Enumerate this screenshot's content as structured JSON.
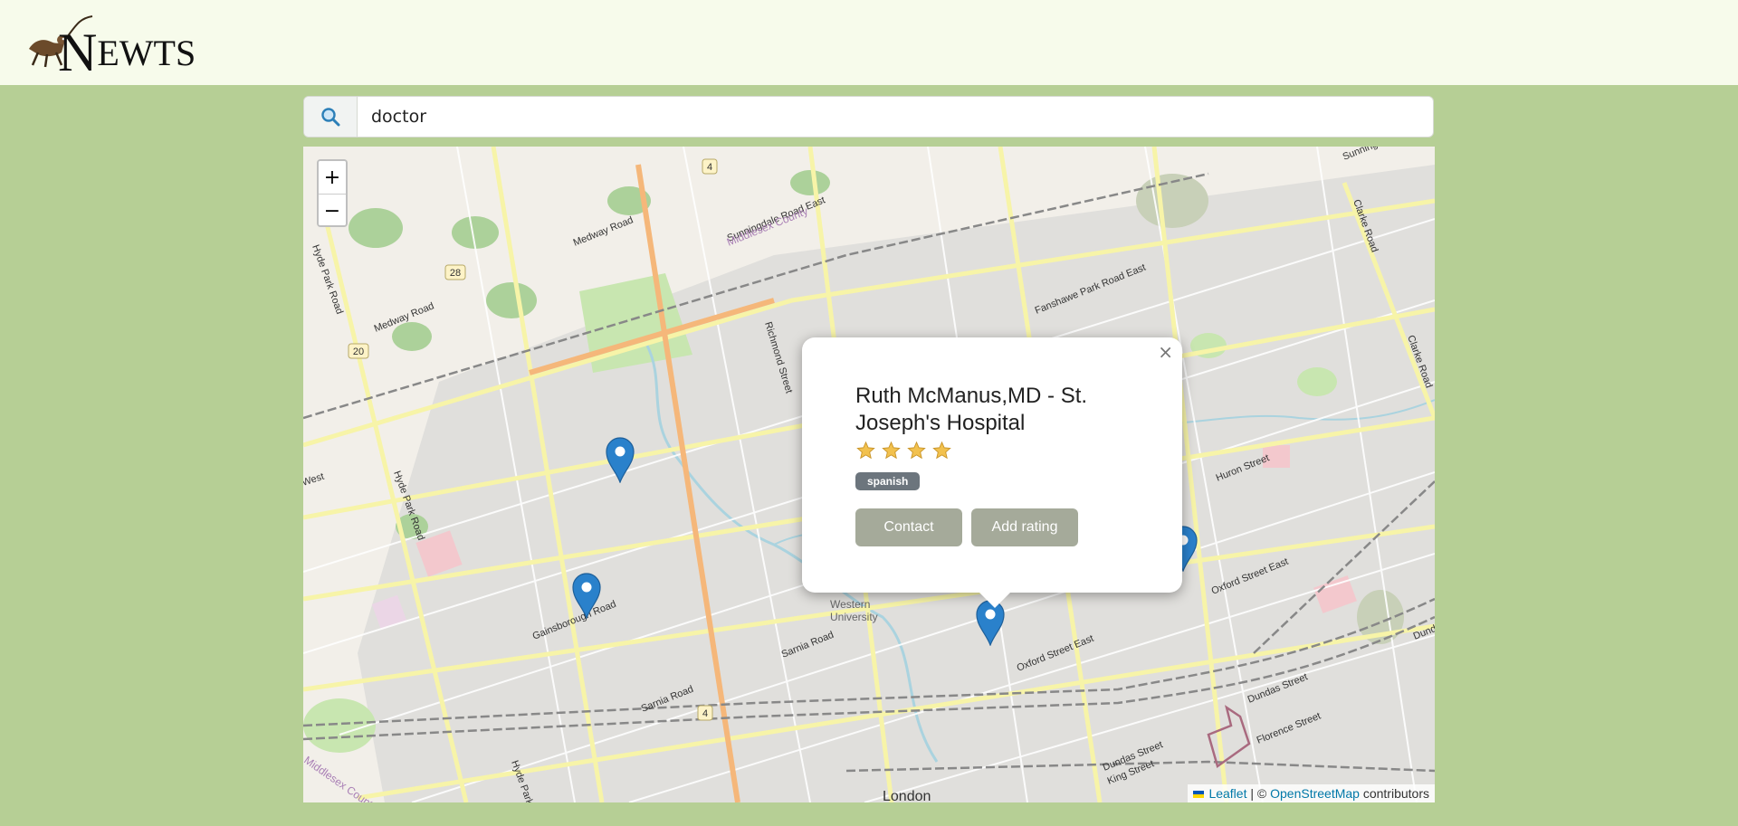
{
  "header": {
    "logo_text_initial": "N",
    "logo_text_rest": "EWTS"
  },
  "search": {
    "value": "doctor",
    "icon": "search-icon"
  },
  "map": {
    "zoom_in_label": "+",
    "zoom_out_label": "−",
    "labels": {
      "medway_road_1": "Medway Road",
      "medway_road_2": "Medway Road",
      "hyde_park_road_1": "Hyde Park Road",
      "hyde_park_road_2": "Hyde Park Road",
      "hyde_park_road_3": "Hyde Park Road",
      "middlesex_county_1": "Middlesex County",
      "middlesex_county_2": "Middlesex County",
      "sunningdale_road_east": "Sunningdale Road East",
      "sunningdale": "Sunningdale",
      "fanshawe_park_road_east": "Fanshawe Park Road East",
      "richmond_street": "Richmond Street",
      "clarke_road_1": "Clarke Road",
      "clarke_road_2": "Clarke Road",
      "huron_street": "Huron Street",
      "oxford_street_east_1": "Oxford Street East",
      "oxford_street_east_2": "Oxford Street East",
      "gainsborough_road": "Gainsborough Road",
      "sarnia_road_1": "Sarnia Road",
      "sarnia_road_2": "Sarnia Road",
      "western_university": "Western University",
      "dundas_street_1": "Dundas Street",
      "dundas_street_2": "Dundas Street",
      "king_street": "King Street",
      "florence_street": "Florence Street",
      "london": "London",
      "west": "West",
      "dund": "Dund",
      "route_4_top": "4",
      "route_4_bottom": "4",
      "route_28": "28",
      "route_20": "20"
    },
    "attribution": {
      "leaflet": "Leaflet",
      "separator": "| ©",
      "osm": "OpenStreetMap",
      "contributors": "contributors"
    }
  },
  "popup": {
    "title": "Ruth McManus,MD - St. Joseph's Hospital",
    "rating": 4,
    "max_rating": 4,
    "tag": "spanish",
    "contact_label": "Contact",
    "add_rating_label": "Add rating",
    "close_label": "×"
  },
  "colors": {
    "page_bg": "#b6cf95",
    "header_bg": "#f7fbeb",
    "marker": "#2a81cb",
    "button": "#a5aa9a",
    "tag": "#6c757d",
    "star": "#f2c14e"
  }
}
